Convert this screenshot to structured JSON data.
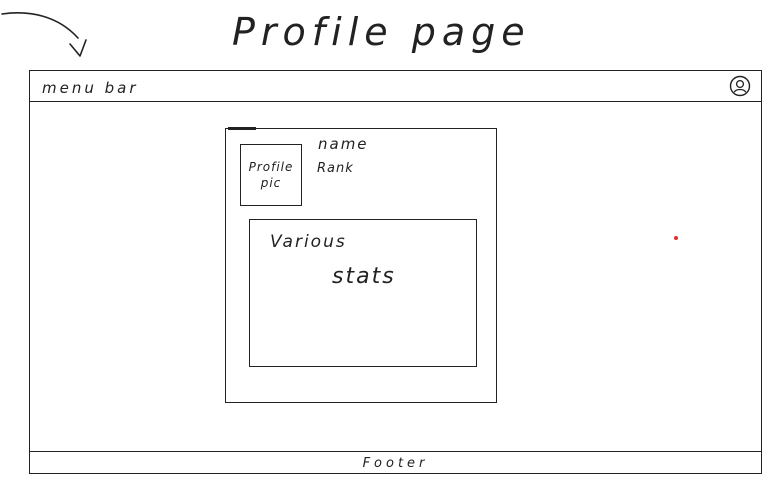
{
  "page": {
    "title": "Profile page"
  },
  "menu_bar": {
    "label": "menu bar",
    "profile_icon": "user-circle-icon"
  },
  "profile_card": {
    "pic_label_line1": "Profile",
    "pic_label_line2": "pic",
    "name_label": "name",
    "rank_label": "Rank",
    "stats": {
      "line1": "Various",
      "line2": "stats"
    }
  },
  "footer": {
    "label": "Footer"
  },
  "annotations": {
    "arrow_icon": "curved-arrow-icon"
  },
  "colors": {
    "ink": "#222222",
    "marker_dot": "#e03030"
  }
}
